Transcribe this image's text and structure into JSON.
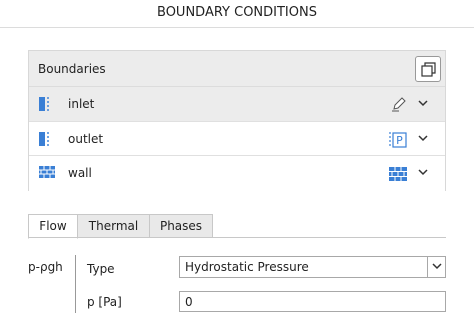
{
  "header": {
    "title": "BOUNDARY CONDITIONS"
  },
  "boundaries": {
    "label": "Boundaries",
    "copy_icon": "copy-icon",
    "items": [
      {
        "name": "inlet",
        "type_icon": "boundary-patch-icon",
        "action_icon": "edit-pencil-icon",
        "selected": true
      },
      {
        "name": "outlet",
        "type_icon": "boundary-patch-icon",
        "action_icon": "pressure-outlet-icon",
        "action_text": "P",
        "selected": false
      },
      {
        "name": "wall",
        "type_icon": "wall-icon",
        "action_icon": "wall-icon",
        "selected": false
      }
    ]
  },
  "tabs": [
    {
      "label": "Flow",
      "active": true
    },
    {
      "label": "Thermal",
      "active": false
    },
    {
      "label": "Phases",
      "active": false
    }
  ],
  "flow": {
    "section_label": "p-ρgh",
    "type_label": "Type",
    "type_value": "Hydrostatic Pressure",
    "p_label": "p [Pa]",
    "p_value": "0"
  },
  "colors": {
    "accent": "#3a7fd5",
    "selected_row": "#ececec",
    "border": "#d8d8d8"
  }
}
